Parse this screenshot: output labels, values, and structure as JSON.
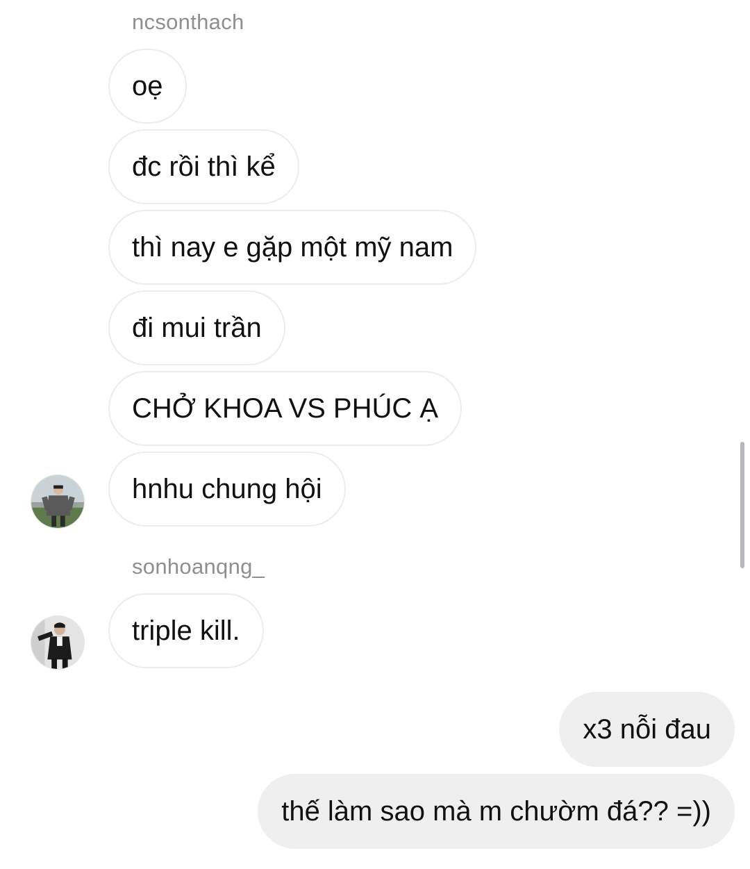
{
  "conversation": {
    "groups": [
      {
        "sender": "ncsonthach",
        "avatar_icon": "user-avatar-icon",
        "messages": [
          "oẹ",
          "đc rồi thì kể",
          "thì nay e gặp một mỹ nam",
          "đi mui trần",
          "CHỞ KHOA VS PHÚC Ạ",
          "hnhu chung hội"
        ]
      },
      {
        "sender": "sonhoanqng_",
        "avatar_icon": "user-avatar-icon",
        "messages": [
          "triple kill."
        ]
      }
    ],
    "outgoing": [
      "x3 nỗi đau",
      "thế làm sao mà m chườm đá?? =))"
    ]
  },
  "colors": {
    "incoming_bubble_bg": "#ffffff",
    "incoming_bubble_border": "#ececec",
    "outgoing_bubble_bg": "#efefef",
    "sender_text": "#8e8e93",
    "message_text": "#111111",
    "scrollbar": "#b8b8bc"
  }
}
